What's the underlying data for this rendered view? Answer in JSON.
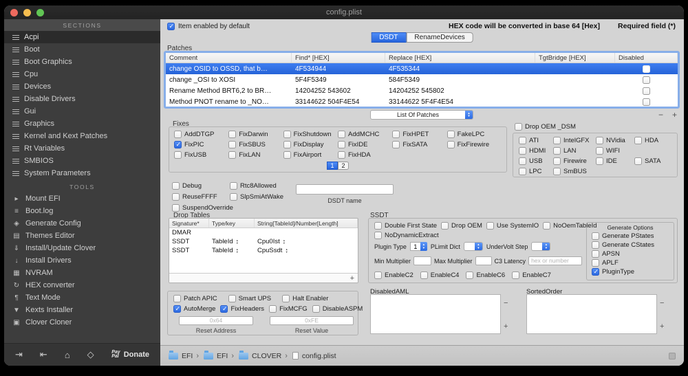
{
  "window": {
    "title": "config.plist"
  },
  "icons": {
    "mount-efi-icon": "▸",
    "boot-log-icon": "≡",
    "generate-config-icon": "◈",
    "themes-editor-icon": "▤",
    "install-clover-icon": "⇓",
    "install-drivers-icon": "↓",
    "nvram-icon": "▦",
    "hex-converter-icon": "↻",
    "text-mode-icon": "¶",
    "kexts-installer-icon": "▼",
    "clover-cloner-icon": "▣",
    "signin-icon": "⇥",
    "export-icon": "⇤",
    "home-icon": "⌂",
    "share-icon": "◇",
    "arrow-up": "▴",
    "arrow-down": "▾",
    "minus-icon": "−",
    "plus-icon": "+"
  },
  "topbar": {
    "enable": {
      "label": "Item enabled by default",
      "checked": true
    },
    "hex_note": "HEX code will be converted in base 64 [Hex]",
    "required_note": "Required field (*)"
  },
  "tabs": [
    {
      "label": "DSDT",
      "active": true
    },
    {
      "label": "RenameDevices",
      "active": false
    }
  ],
  "sidebar": {
    "sections_header": "SECTIONS",
    "sections": [
      {
        "label": "Acpi",
        "selected": true
      },
      {
        "label": "Boot"
      },
      {
        "label": "Boot Graphics"
      },
      {
        "label": "Cpu"
      },
      {
        "label": "Devices"
      },
      {
        "label": "Disable Drivers"
      },
      {
        "label": "Gui"
      },
      {
        "label": "Graphics"
      },
      {
        "label": "Kernel and Kext Patches"
      },
      {
        "label": "Rt Variables"
      },
      {
        "label": "SMBIOS"
      },
      {
        "label": "System Parameters"
      }
    ],
    "tools_header": "TOOLS",
    "tools": [
      {
        "label": "Mount EFI",
        "icon": "mount-efi-icon"
      },
      {
        "label": "Boot.log",
        "icon": "boot-log-icon"
      },
      {
        "label": "Generate Config",
        "icon": "generate-config-icon"
      },
      {
        "label": "Themes Editor",
        "icon": "themes-editor-icon"
      },
      {
        "label": "Install/Update Clover",
        "icon": "install-clover-icon"
      },
      {
        "label": "Install Drivers",
        "icon": "install-drivers-icon"
      },
      {
        "label": "NVRAM",
        "icon": "nvram-icon"
      },
      {
        "label": "HEX converter",
        "icon": "hex-converter-icon"
      },
      {
        "label": "Text Mode",
        "icon": "text-mode-icon"
      },
      {
        "label": "Kexts Installer",
        "icon": "kexts-installer-icon"
      },
      {
        "label": "Clover Cloner",
        "icon": "clover-cloner-icon"
      }
    ],
    "footer": {
      "icons": [
        {
          "icon": "signin-icon"
        },
        {
          "icon": "export-icon"
        },
        {
          "icon": "home-icon"
        },
        {
          "icon": "share-icon"
        }
      ],
      "paypal_top": "Pay",
      "paypal_bottom": "Pal",
      "donate": "Donate"
    }
  },
  "patches": {
    "title": "Patches",
    "columns": [
      "Comment",
      "Find* [HEX]",
      "Replace [HEX]",
      "TgtBridge [HEX]",
      "Disabled"
    ],
    "rows": [
      {
        "comment": "change OSID to OSSD, that b…",
        "find": "4F534944",
        "replace": "4F535344",
        "tgt": "",
        "selected": true,
        "disabled": false
      },
      {
        "comment": "change _OSI to XOSI",
        "find": "5F4F5349",
        "replace": "584F5349",
        "tgt": "",
        "disabled": false
      },
      {
        "comment": "Rename Method BRT6,2 to BR…",
        "find": "14204252 543602",
        "replace": "14204252 545802",
        "tgt": "",
        "disabled": false
      },
      {
        "comment": "Method PNOT rename to _NO…",
        "find": "33144622 504F4E54",
        "replace": "33144622 5F4F4E54",
        "tgt": "",
        "disabled": false
      }
    ],
    "list_dropdown": "List Of Patches"
  },
  "fixes": {
    "title": "Fixes",
    "items": [
      {
        "label": "AddDTGP"
      },
      {
        "label": "FixDarwin"
      },
      {
        "label": "FixShutdown"
      },
      {
        "label": "AddMCHC"
      },
      {
        "label": "FixHPET"
      },
      {
        "label": "FakeLPC"
      },
      {
        "label": "FixPIC",
        "checked": true
      },
      {
        "label": "FixSBUS"
      },
      {
        "label": "FixDisplay"
      },
      {
        "label": "FixIDE"
      },
      {
        "label": "FixSATA"
      },
      {
        "label": "FixFirewire"
      },
      {
        "label": "FixUSB"
      },
      {
        "label": "FixLAN"
      },
      {
        "label": "FixAirport"
      },
      {
        "label": "FixHDA"
      }
    ],
    "pages": [
      {
        "label": "1",
        "active": true
      },
      {
        "label": "2"
      }
    ]
  },
  "devices": {
    "drop_oem": {
      "label": "Drop OEM _DSM",
      "checked": false
    },
    "items": [
      {
        "label": "ATI"
      },
      {
        "label": "IntelGFX"
      },
      {
        "label": "NVidia"
      },
      {
        "label": "HDA"
      },
      {
        "label": "HDMI"
      },
      {
        "label": "LAN"
      },
      {
        "label": "WIFI"
      },
      {
        "label": "",
        "blank": true
      },
      {
        "label": "USB"
      },
      {
        "label": "Firewire"
      },
      {
        "label": "IDE"
      },
      {
        "label": "SATA"
      },
      {
        "label": "LPC"
      },
      {
        "label": "SmBUS"
      }
    ]
  },
  "misc": {
    "items": [
      {
        "label": "Debug"
      },
      {
        "label": "Rtc8Allowed"
      },
      {
        "label": "ReuseFFFF"
      },
      {
        "label": "SlpSmiAtWake"
      },
      {
        "label": "SuspendOverride"
      },
      {
        "label": "",
        "blank": true
      }
    ],
    "dsdt_name_label": "DSDT name",
    "dsdt_name_value": ""
  },
  "drop_tables": {
    "title": "Drop Tables",
    "columns": [
      "Signature*",
      "Type/key",
      "String[TableId]/Number[Length]"
    ],
    "rows": [
      {
        "signature": "DMAR",
        "type": "",
        "value": "",
        "steppers": false
      },
      {
        "signature": "SSDT",
        "type": "TableId",
        "value": "Cpu0Ist",
        "steppers": true
      },
      {
        "signature": "SSDT",
        "type": "TableId",
        "value": "CpuSsdt",
        "steppers": true
      }
    ]
  },
  "ssdt": {
    "title": "SSDT",
    "checks_row1": [
      {
        "label": "Double First State"
      },
      {
        "label": "Drop OEM"
      },
      {
        "label": "Use SystemIO"
      },
      {
        "label": "NoOemTableId"
      }
    ],
    "checks_row2": [
      {
        "label": "NoDynamicExtract"
      }
    ],
    "plugin_type_label": "Plugin Type",
    "plugin_type_value": "1",
    "plimit_label": "PLimit Dict",
    "plimit_value": "",
    "undervolt_label": "UnderVolt Step",
    "undervolt_value": "",
    "min_label": "Min Multiplier",
    "max_label": "Max Multiplier",
    "c3_label": "C3 Latency",
    "c3_placeholder": "hex or number",
    "enables": [
      {
        "label": "EnableC2"
      },
      {
        "label": "EnableC4"
      },
      {
        "label": "EnableC6"
      },
      {
        "label": "EnableC7"
      }
    ],
    "generate": {
      "title": "Generate Options",
      "items": [
        {
          "label": "Generate PStates"
        },
        {
          "label": "Generate CStates"
        },
        {
          "label": "APSN"
        },
        {
          "label": "APLF"
        },
        {
          "label": "PluginType",
          "checked": true
        }
      ]
    }
  },
  "apic_box": {
    "row1": [
      {
        "label": "Patch APIC"
      },
      {
        "label": "Smart UPS"
      },
      {
        "label": "Halt Enabler"
      }
    ],
    "row2": [
      {
        "label": "AutoMerge",
        "checked": true
      },
      {
        "label": "FixHeaders",
        "checked": true
      },
      {
        "label": "FixMCFG"
      },
      {
        "label": "DisableASPM"
      }
    ],
    "reset_address": {
      "placeholder": "0x64",
      "label": "Reset Address"
    },
    "reset_value": {
      "placeholder": "0xFE",
      "label": "Reset Value"
    }
  },
  "aml": {
    "disabled_label": "DisabledAML",
    "sorted_label": "SortedOrder"
  },
  "statusbar": {
    "crumbs": [
      {
        "label": "EFI",
        "sep": "›"
      },
      {
        "label": "EFI",
        "sep": "›"
      },
      {
        "label": "CLOVER",
        "sep": "›"
      },
      {
        "label": "config.plist",
        "is_file": true,
        "sep": ""
      }
    ]
  }
}
